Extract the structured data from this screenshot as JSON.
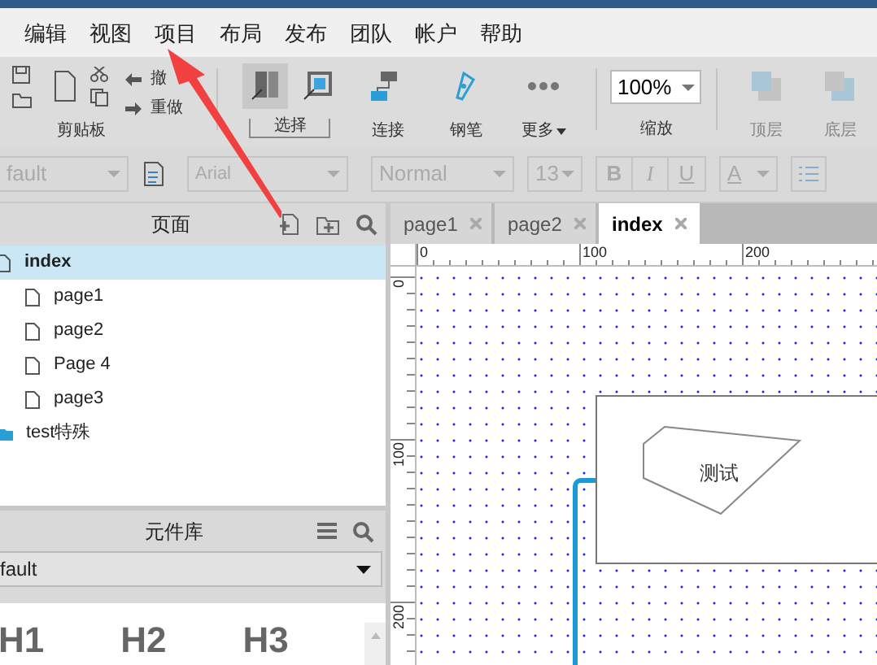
{
  "menu": [
    {
      "label": "编辑"
    },
    {
      "label": "视图"
    },
    {
      "label": "项目"
    },
    {
      "label": "布局"
    },
    {
      "label": "发布"
    },
    {
      "label": "团队"
    },
    {
      "label": "帐户"
    },
    {
      "label": "帮助"
    }
  ],
  "toolbar": {
    "clipboard": "剪贴板",
    "undo": "撤",
    "redo": "重做",
    "tools": [
      {
        "kind": "select",
        "label": "选择",
        "selected": true
      },
      {
        "kind": "connect",
        "label": "连接",
        "selected": false
      },
      {
        "kind": "pen",
        "label": "钢笔",
        "selected": false
      },
      {
        "kind": "more",
        "label": "更多",
        "selected": false
      }
    ],
    "zoom": {
      "value": "100%",
      "label": "缩放"
    },
    "layers": [
      {
        "label": "顶层",
        "disabled": true
      },
      {
        "label": "底层",
        "disabled": true
      }
    ]
  },
  "format_bar": {
    "style": "fault",
    "font": "Arial",
    "weight": "Normal",
    "size": "13",
    "bold": "B",
    "italic": "I",
    "underline": "U",
    "font_color_label": "A",
    "disabled": true
  },
  "pages_panel": {
    "title": "页面",
    "tree": [
      {
        "label": "index",
        "kind": "page",
        "selected": true,
        "children": [
          {
            "label": "page1",
            "kind": "page",
            "selected": false
          },
          {
            "label": "page2",
            "kind": "page",
            "selected": false
          },
          {
            "label": "Page 4",
            "kind": "page",
            "selected": false
          },
          {
            "label": "page3",
            "kind": "page",
            "selected": false
          }
        ]
      },
      {
        "label": "test特殊",
        "kind": "folder",
        "selected": false
      }
    ]
  },
  "library_panel": {
    "title": "元件库",
    "library": "fault",
    "widgets": [
      "H1",
      "H2",
      "H3"
    ]
  },
  "tabs": [
    {
      "label": "page1",
      "selected": false
    },
    {
      "label": "page2",
      "selected": false
    },
    {
      "label": "index",
      "selected": true
    }
  ],
  "rulers": {
    "x_labels": [
      "0",
      "100",
      "200"
    ],
    "y_labels": [
      "0",
      "100",
      "200"
    ]
  },
  "canvas": {
    "shape_text": "测试"
  }
}
